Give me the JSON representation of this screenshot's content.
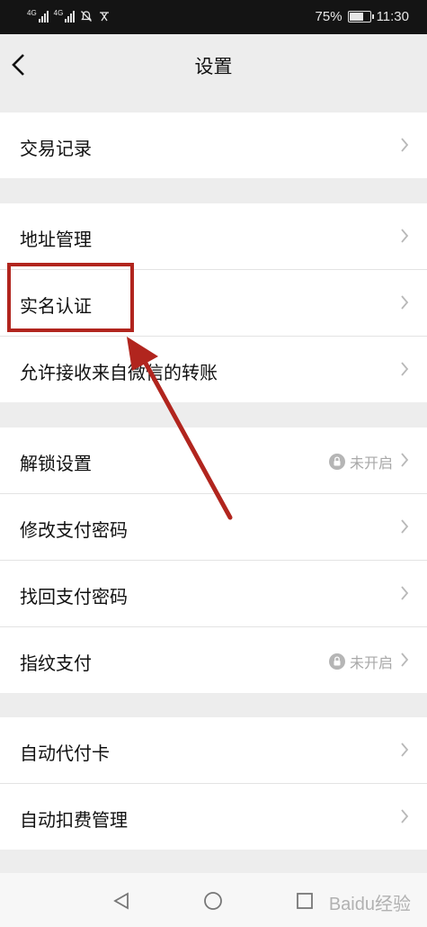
{
  "status_bar": {
    "network1": "4G",
    "network2": "4G",
    "battery": "75%",
    "battery_level": 0.75,
    "time": "11:30"
  },
  "header": {
    "title": "设置"
  },
  "groups": [
    {
      "items": [
        {
          "label": "交易记录"
        }
      ]
    },
    {
      "items": [
        {
          "label": "地址管理"
        },
        {
          "label": "实名认证"
        },
        {
          "label": "允许接收来自微信的转账"
        }
      ]
    },
    {
      "items": [
        {
          "label": "解锁设置",
          "status": "未开启"
        },
        {
          "label": "修改支付密码"
        },
        {
          "label": "找回支付密码"
        },
        {
          "label": "指纹支付",
          "status": "未开启"
        }
      ]
    },
    {
      "items": [
        {
          "label": "自动代付卡"
        },
        {
          "label": "自动扣费管理"
        }
      ]
    }
  ],
  "annotation_color": "#b1251e",
  "watermark": "Baidu经验"
}
